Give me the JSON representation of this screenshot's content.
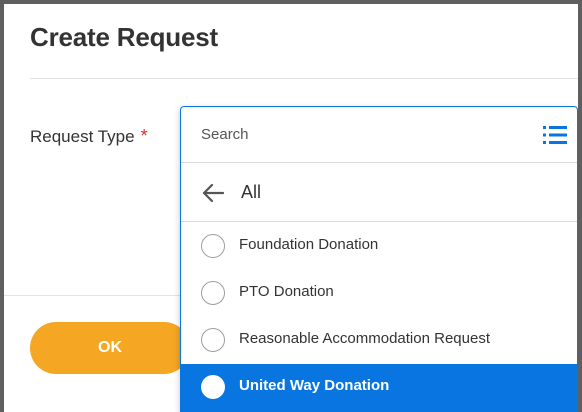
{
  "dialog": {
    "title": "Create Request",
    "field_label": "Request Type",
    "required_marker": "*",
    "ok_label": "OK"
  },
  "dropdown": {
    "search_placeholder": "Search",
    "back_label": "All",
    "options": [
      {
        "label": "Foundation Donation",
        "selected": false
      },
      {
        "label": "PTO Donation",
        "selected": false
      },
      {
        "label": "Reasonable Accommodation Request",
        "selected": false
      },
      {
        "label": "United Way Donation",
        "selected": true
      }
    ]
  },
  "icons": {
    "list": "list-icon",
    "back": "arrow-left-icon",
    "radio": "radio-icon"
  },
  "colors": {
    "accent": "#0875e1",
    "ok_button": "#f5a623",
    "required": "#de2e21"
  }
}
